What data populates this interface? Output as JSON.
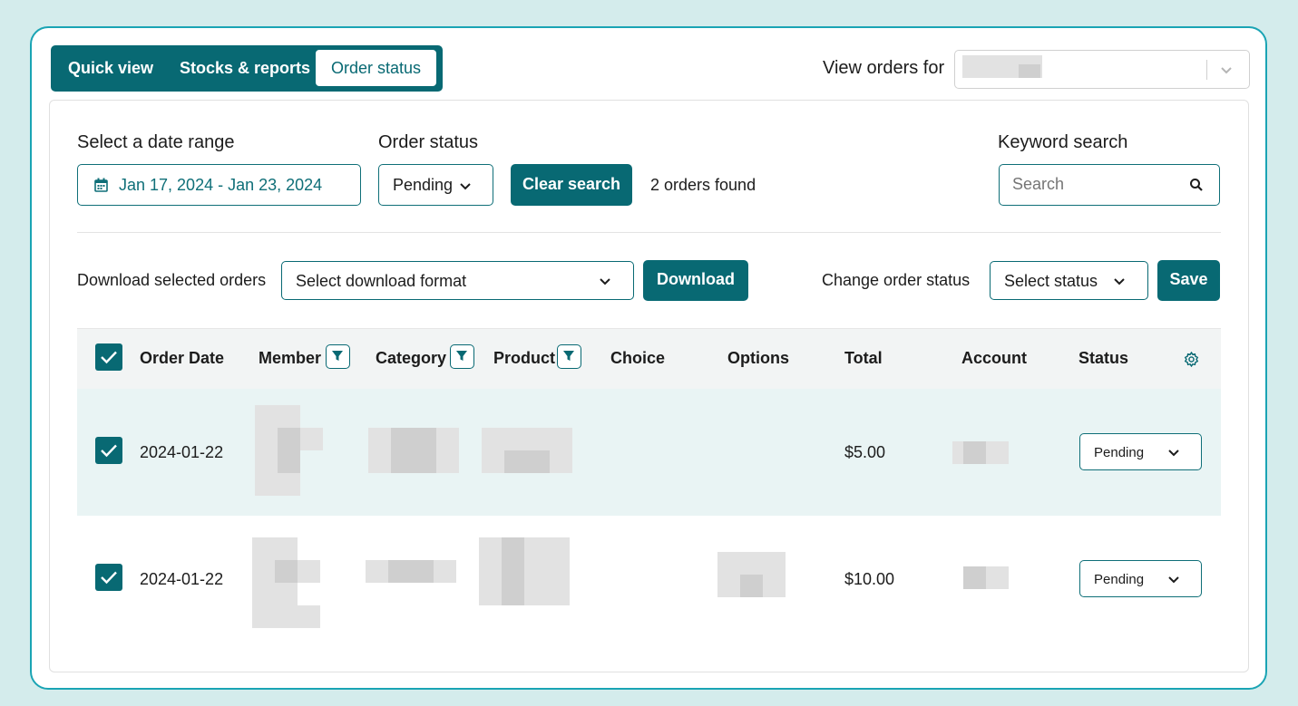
{
  "tabs": [
    {
      "label": "Quick view",
      "active": false
    },
    {
      "label": "Stocks & reports",
      "active": false
    },
    {
      "label": "Order status",
      "active": true
    }
  ],
  "view_orders": {
    "label": "View orders for",
    "value": ""
  },
  "filters": {
    "date_label": "Select a date range",
    "date_value": "Jan 17, 2024 - Jan 23, 2024",
    "status_label": "Order status",
    "status_value": "Pending",
    "clear_button": "Clear search",
    "result_count": "2 orders found",
    "keyword_label": "Keyword search",
    "keyword_placeholder": "Search"
  },
  "actions": {
    "download_label": "Download selected orders",
    "download_format_placeholder": "Select download format",
    "download_button": "Download",
    "change_status_label": "Change order status",
    "status_placeholder": "Select status",
    "save_button": "Save"
  },
  "table": {
    "columns": [
      "Order Date",
      "Member",
      "Category",
      "Product",
      "Choice",
      "Options",
      "Total",
      "Account",
      "Status"
    ],
    "rows": [
      {
        "selected": true,
        "order_date": "2024-01-22",
        "total": "$5.00",
        "status": "Pending"
      },
      {
        "selected": true,
        "order_date": "2024-01-22",
        "total": "$10.00",
        "status": "Pending"
      }
    ]
  },
  "colors": {
    "primary": "#086973",
    "accent_border": "#1aa4b4",
    "background": "#d4ecec",
    "selected_row": "#e9f4f4"
  },
  "icons": [
    "calendar-icon",
    "chevron-down-icon",
    "search-icon",
    "filter-icon",
    "gear-icon",
    "check-icon"
  ]
}
